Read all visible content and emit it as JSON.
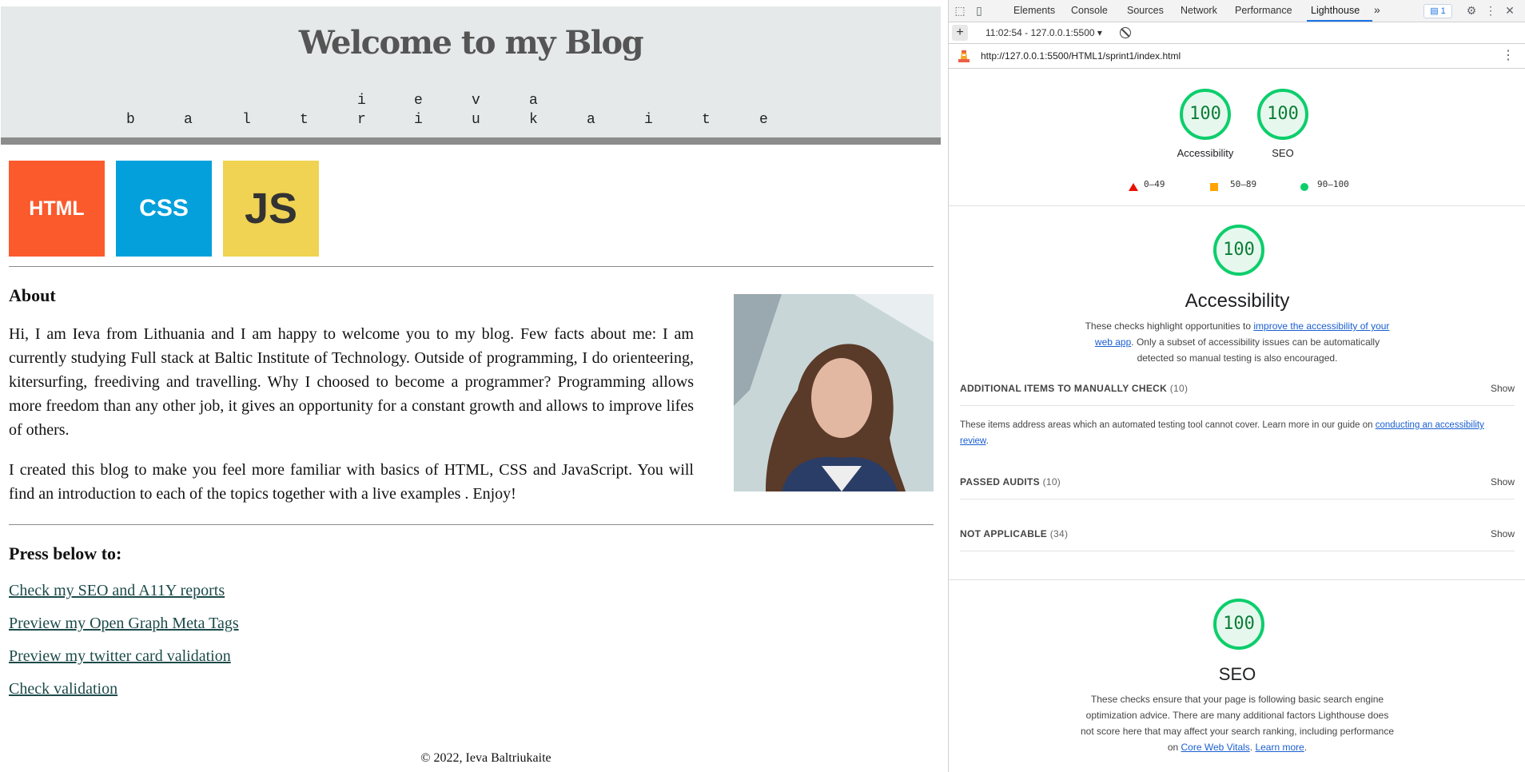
{
  "blog": {
    "title": "Welcome to my Blog",
    "name_line1": [
      "i",
      "e",
      "v",
      "a"
    ],
    "name_line2": [
      "b",
      "a",
      "l",
      "t",
      "r",
      "i",
      "u",
      "k",
      "a",
      "i",
      "t",
      "e"
    ],
    "logos": {
      "html": "HTML",
      "css": "CSS",
      "js": "JS"
    },
    "about_heading": "About",
    "about_p1": "Hi, I am Ieva from Lithuania and I am happy to welcome you to my blog. Few facts about me: I am currently studying Full stack at Baltic Institute of Technology. Outside of programming, I do orienteering, kitersurfing, freediving and travelling. Why I choosed to become a programmer? Programming allows more freedom than any other job, it gives an opportunity for a constant growth and allows to improve lifes of others.",
    "about_p2": "I created this blog to make you feel more familiar with basics of HTML, CSS and JavaScript. You will find an introduction to each of the topics together with a live examples . Enjoy!",
    "press_heading": "Press below to:",
    "links": [
      "Check my SEO and A11Y reports",
      "Preview my Open Graph Meta Tags",
      "Preview my twitter card validation",
      "Check validation"
    ],
    "footer": "© 2022, Ieva Baltriukaite"
  },
  "devtools": {
    "tabs": [
      "Elements",
      "Console",
      "Sources",
      "Network",
      "Performance",
      "Lighthouse"
    ],
    "more_tabs": "»",
    "issues_count": "1",
    "report_select": "11:02:54 - 127.0.0.1:5500 ▾",
    "add_label": "+",
    "url": "http://127.0.0.1:5500/HTML1/sprint1/index.html",
    "url_menu": "⋮"
  },
  "lighthouse": {
    "summary": [
      {
        "label": "Accessibility",
        "score": "100"
      },
      {
        "label": "SEO",
        "score": "100"
      }
    ],
    "legend": {
      "fail": "0–49",
      "average": "50–89",
      "pass": "90–100"
    },
    "accessibility": {
      "score": "100",
      "title": "Accessibility",
      "desc_pre": "These checks highlight opportunities to ",
      "desc_link": "improve the accessibility of your web app",
      "desc_post": ". Only a subset of accessibility issues can be automatically detected so manual testing is also encouraged.",
      "manual_title": "ADDITIONAL ITEMS TO MANUALLY CHECK",
      "manual_count": "(10)",
      "manual_desc_pre": "These items address areas which an automated testing tool cannot cover. Learn more in our guide on ",
      "manual_desc_link": "conducting an accessibility review",
      "manual_desc_post": ".",
      "passed_title": "PASSED AUDITS",
      "passed_count": "(10)",
      "na_title": "NOT APPLICABLE",
      "na_count": "(34)",
      "show": "Show"
    },
    "seo": {
      "score": "100",
      "title": "SEO",
      "desc_pre": "These checks ensure that your page is following basic search engine optimization advice. There are many additional factors Lighthouse does not score here that may affect your search ranking, including performance on ",
      "desc_link1": "Core Web Vitals",
      "desc_mid": ". ",
      "desc_link2": "Learn more",
      "desc_post": "."
    },
    "colors": {
      "pass": "#0cce6b",
      "pass_text": "#0b7d36",
      "pass_bg": "#e6f8ee"
    }
  }
}
